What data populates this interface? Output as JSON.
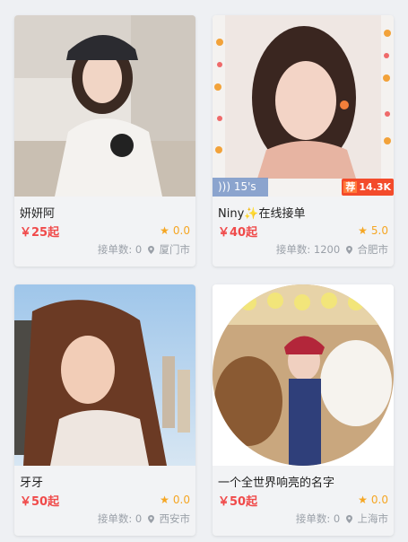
{
  "cards": [
    {
      "name": "妍妍阿",
      "price": "￥25起",
      "rating": "0.0",
      "orders_label": "接单数: 0",
      "city": "厦门市"
    },
    {
      "name": "Niny✨在线接单",
      "price": "￥40起",
      "rating": "5.0",
      "orders_label": "接单数: 1200",
      "city": "合肥市",
      "audio": "15's",
      "hot_tag": "荐",
      "hot_count": "14.3K"
    },
    {
      "name": "牙牙",
      "price": "￥50起",
      "rating": "0.0",
      "orders_label": "接单数: 0",
      "city": "西安市"
    },
    {
      "name": "一个全世界响亮的名字",
      "price": "￥50起",
      "rating": "0.0",
      "orders_label": "接单数: 0",
      "city": "上海市"
    }
  ],
  "colors": {
    "price": "#f04a4a",
    "star": "#f5a623",
    "meta": "#9aa0a8"
  }
}
